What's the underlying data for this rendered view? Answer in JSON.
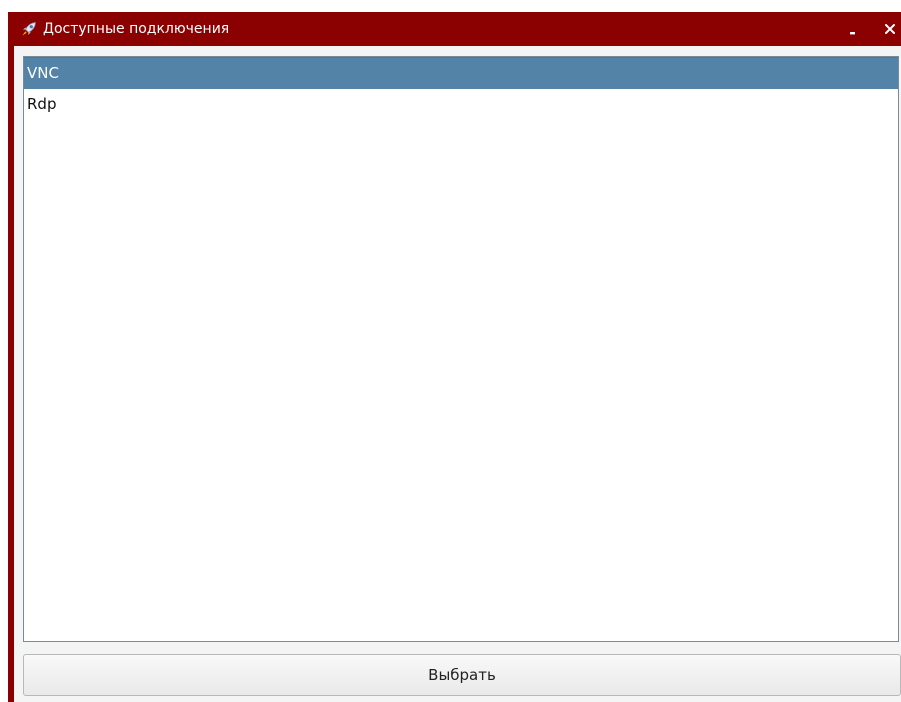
{
  "window": {
    "title": "Доступные подключения",
    "minimize_label": "_",
    "close_label": "×",
    "title_icon": "rocket-icon",
    "title_bar_color": "#8b0000"
  },
  "list": {
    "items": [
      {
        "label": "VNC",
        "selected": true
      },
      {
        "label": "Rdp",
        "selected": false
      }
    ],
    "selection_color": "#5483a8"
  },
  "select_button": {
    "label": "Выбрать"
  }
}
